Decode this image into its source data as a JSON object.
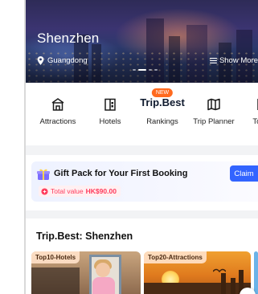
{
  "hero": {
    "city": "Shenzhen",
    "region": "Guangdong",
    "show_more": "Show More",
    "slide_count": 4,
    "active_slide": 2
  },
  "nav": {
    "items": [
      {
        "label": "Attractions",
        "icon": "attractions-icon"
      },
      {
        "label": "Hotels",
        "icon": "hotel-icon"
      },
      {
        "label": "Rankings",
        "icon": "tripbest-logo",
        "logo_text": "Trip.Best",
        "badge": "NEW"
      },
      {
        "label": "Trip Planner",
        "icon": "trip-planner-icon"
      },
      {
        "label": "Tours",
        "icon": "tours-icon"
      }
    ]
  },
  "gift": {
    "title": "Gift Pack for Your First Booking",
    "claim_label": "Claim",
    "total_label": "Total value",
    "total_value": "HK$90.00"
  },
  "best": {
    "title": "Trip.Best: Shenzhen",
    "cards": [
      {
        "tag": "Top10-Hotels"
      },
      {
        "tag": "Top20-Attractions"
      }
    ]
  },
  "colors": {
    "accent": "#3264ff",
    "badge": "#ff6a1f",
    "price": "#ff3b5c"
  }
}
